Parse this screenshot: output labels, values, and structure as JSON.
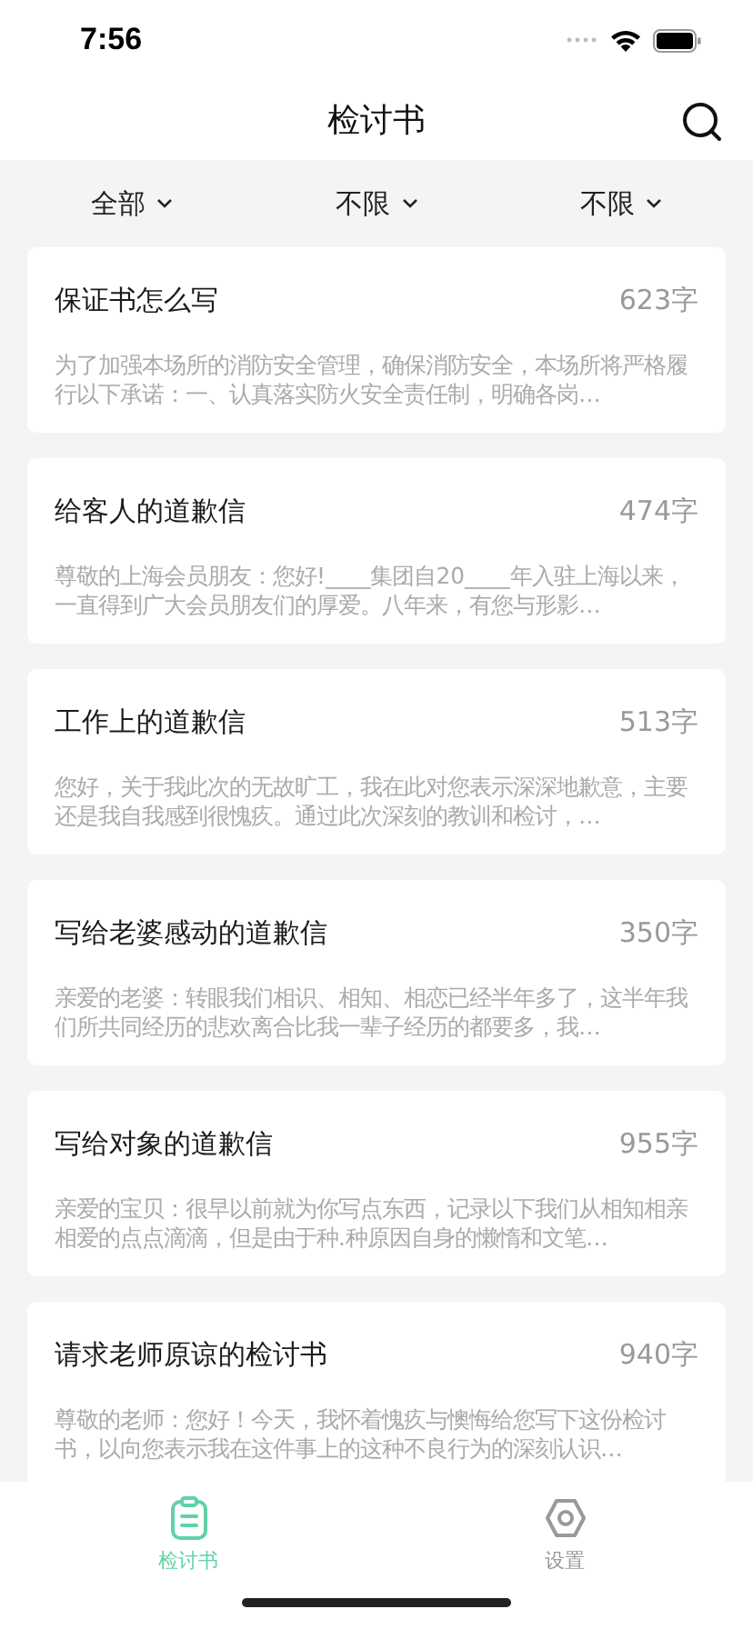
{
  "status_bar": {
    "time": "7:56"
  },
  "header": {
    "title": "检讨书"
  },
  "filters": [
    {
      "label": "全部"
    },
    {
      "label": "不限"
    },
    {
      "label": "不限"
    }
  ],
  "letters": [
    {
      "title": "保证书怎么写",
      "count": "623字",
      "preview": "为了加强本场所的消防安全管理，确保消防安全，本场所将严格履行以下承诺：一、认真落实防火安全责任制，明确各岗…"
    },
    {
      "title": "给客人的道歉信",
      "count": "474字",
      "preview": "尊敬的上海会员朋友：您好!____集团自20____年入驻上海以来，一直得到广大会员朋友们的厚爱。八年来，有您与形影…"
    },
    {
      "title": "工作上的道歉信",
      "count": "513字",
      "preview": "您好，关于我此次的无故旷工，我在此对您表示深深地歉意，主要还是我自我感到很愧疚。通过此次深刻的教训和检讨，…"
    },
    {
      "title": "写给老婆感动的道歉信",
      "count": "350字",
      "preview": "亲爱的老婆：转眼我们相识、相知、相恋已经半年多了，这半年我们所共同经历的悲欢离合比我一辈子经历的都要多，我…"
    },
    {
      "title": "写给对象的道歉信",
      "count": "955字",
      "preview": "亲爱的宝贝：很早以前就为你写点东西，记录以下我们从相知相亲相爱的点点滴滴，但是由于种.种原因自身的懒惰和文笔…"
    },
    {
      "title": "请求老师原谅的检讨书",
      "count": "940字",
      "preview": "尊敬的老师：您好！今天，我怀着愧疚与懊悔给您写下这份检讨书，以向您表示我在这件事上的这种不良行为的深刻认识…"
    }
  ],
  "tab_bar": [
    {
      "label": "检讨书",
      "kind": "document",
      "selected": true
    },
    {
      "label": "设置",
      "kind": "settings",
      "selected": false
    }
  ]
}
